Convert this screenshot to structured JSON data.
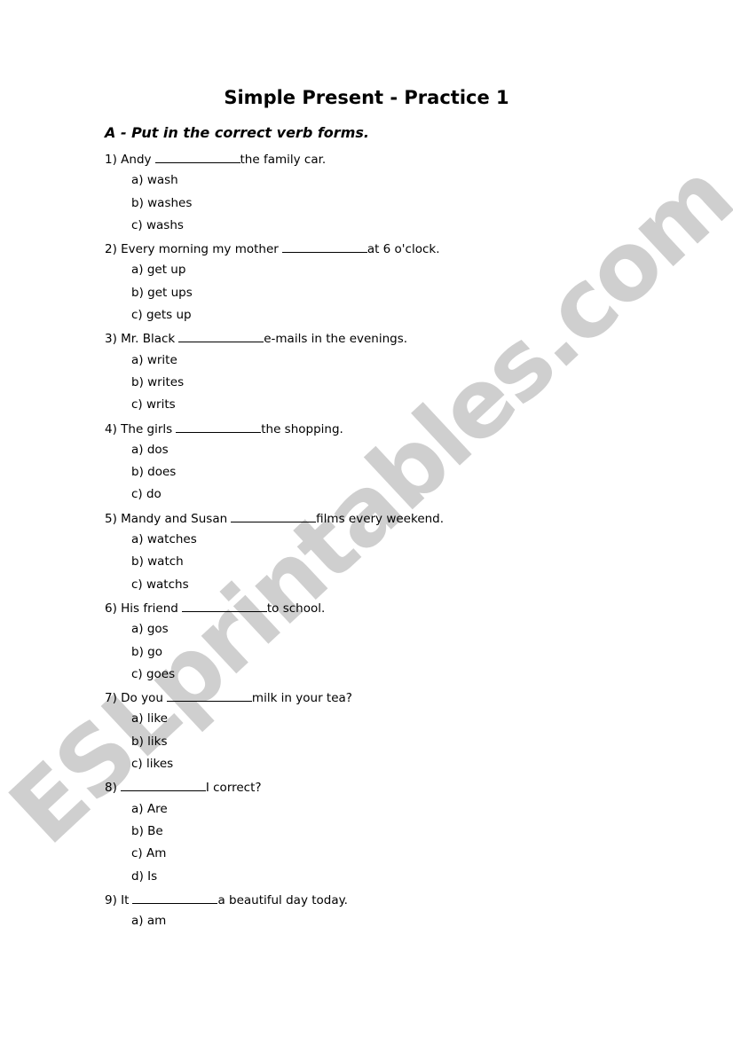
{
  "document": {
    "title": "Simple Present - Practice 1",
    "section_heading": "A - Put in the correct verb forms.",
    "watermark": "ESLprintables.com",
    "questions": [
      {
        "number": "1)",
        "before": "Andy",
        "after": "the family car.",
        "options": [
          "a) wash",
          "b) washes",
          "c) washs"
        ]
      },
      {
        "number": "2)",
        "before": "Every morning my mother",
        "after": "at 6 o'clock.",
        "options": [
          "a) get up",
          "b) get ups",
          "c) gets up"
        ]
      },
      {
        "number": "3)",
        "before": "Mr. Black",
        "after": "e-mails in the evenings.",
        "options": [
          "a) write",
          "b) writes",
          "c) writs"
        ]
      },
      {
        "number": "4)",
        "before": "The girls",
        "after": "the shopping.",
        "options": [
          "a) dos",
          "b) does",
          "c) do"
        ]
      },
      {
        "number": "5)",
        "before": "Mandy and Susan",
        "after": "films every weekend.",
        "options": [
          "a) watches",
          "b) watch",
          "c) watchs"
        ]
      },
      {
        "number": "6)",
        "before": "His friend",
        "after": "to school.",
        "options": [
          "a) gos",
          "b) go",
          "c) goes"
        ]
      },
      {
        "number": "7)",
        "before": "Do you",
        "after": "milk in your tea?",
        "options": [
          "a) like",
          "b) liks",
          "c) likes"
        ]
      },
      {
        "number": "8)",
        "before": "",
        "after": "I correct?",
        "options": [
          "a) Are",
          "b) Be",
          "c) Am",
          "d) Is"
        ]
      },
      {
        "number": "9)",
        "before": "It",
        "after": "a beautiful day today.",
        "options": [
          "a) am"
        ]
      }
    ]
  }
}
